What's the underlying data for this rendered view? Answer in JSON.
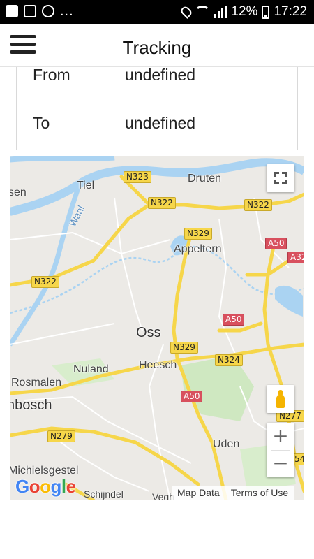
{
  "status_bar": {
    "battery": "12%",
    "time": "17:22",
    "dots": "...",
    "icons": [
      "flipboard-icon",
      "news-icon",
      "whatsapp-icon",
      "location-icon",
      "wifi-icon",
      "signal-icon",
      "battery-icon"
    ]
  },
  "app_bar": {
    "title": "Tracking",
    "menu_icon": "hamburger-menu-icon"
  },
  "route": {
    "from_label": "From",
    "from_value": "undefined",
    "to_label": "To",
    "to_value": "undefined"
  },
  "map": {
    "places": {
      "tiel": "Tiel",
      "druten": "Druten",
      "appeltern": "Appeltern",
      "oss": "Oss",
      "nuland": "Nuland",
      "heesch": "Heesch",
      "rosmalen": "Rosmalen",
      "bosch": "nbosch",
      "uden": "Uden",
      "michielsgestel": "Michielsgestel",
      "schijndel": "Schijndel",
      "sen": "sen",
      "waal": "Waal",
      "veghel": "Vegh"
    },
    "roads": {
      "n323": "N323",
      "n322_a": "N322",
      "n322_b": "N322",
      "n322_c": "N322",
      "n329_a": "N329",
      "n329_b": "N329",
      "n324": "N324",
      "n277": "N277",
      "n279": "N279",
      "a50_a": "A50",
      "a50_b": "A50",
      "a50_c": "A50",
      "a32": "A32",
      "r54": "54"
    },
    "controls": {
      "zoom_in": "+",
      "zoom_out": "−"
    },
    "logo": "Google",
    "map_data": "Map Data",
    "terms": "Terms of Use"
  },
  "colors": {
    "water": "#aad3f2",
    "land": "#eceae6",
    "road_major": "#f6d64a",
    "highway_badge": "#d8505e",
    "park": "#cfe8c1"
  }
}
